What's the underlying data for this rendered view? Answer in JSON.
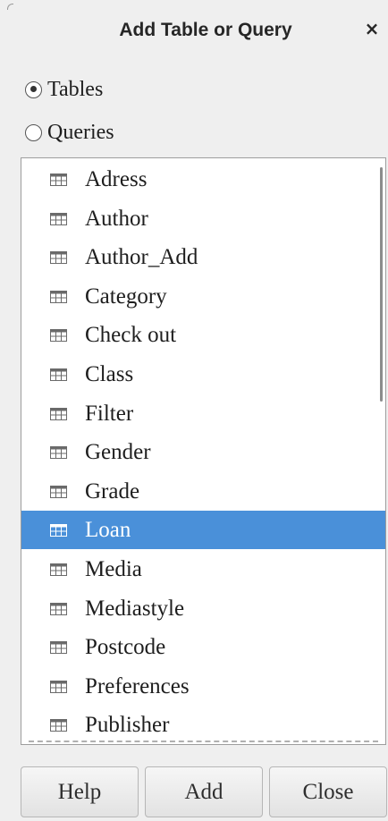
{
  "dialog": {
    "title": "Add Table or Query",
    "close_label": "×"
  },
  "source": {
    "options": [
      {
        "label": "Tables",
        "checked": true
      },
      {
        "label": "Queries",
        "checked": false
      }
    ]
  },
  "list": {
    "icon": "table-icon",
    "items": [
      {
        "label": "Adress"
      },
      {
        "label": "Author"
      },
      {
        "label": "Author_Add"
      },
      {
        "label": "Category"
      },
      {
        "label": "Check out"
      },
      {
        "label": "Class"
      },
      {
        "label": "Filter"
      },
      {
        "label": "Gender"
      },
      {
        "label": "Grade"
      },
      {
        "label": "Loan",
        "selected": true
      },
      {
        "label": "Media"
      },
      {
        "label": "Mediastyle"
      },
      {
        "label": "Postcode"
      },
      {
        "label": "Preferences"
      },
      {
        "label": "Publisher"
      }
    ]
  },
  "buttons": {
    "help": "Help",
    "add": "Add",
    "close": "Close"
  },
  "colors": {
    "selection": "#4a90d9",
    "selection_text": "#ffffff",
    "background": "#efefef"
  }
}
